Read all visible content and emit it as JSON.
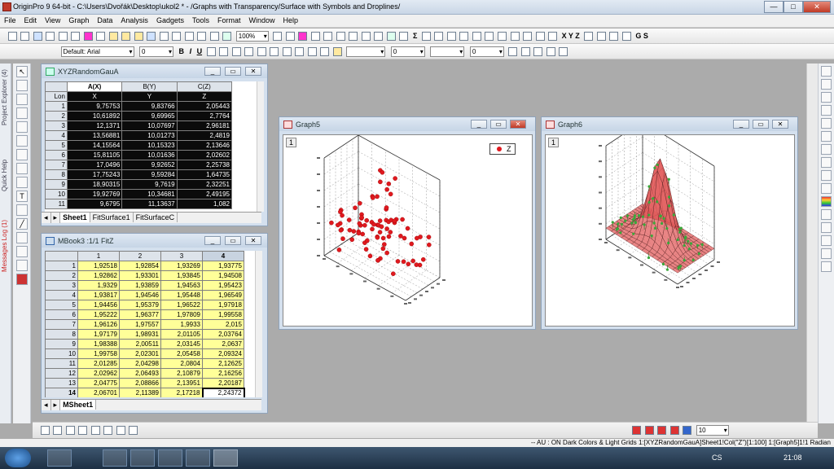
{
  "app": {
    "title": "OriginPro 9 64-bit - C:\\Users\\Dvořák\\Desktop\\ukol2 * - /Graphs with Transparency/Surface with Symbols and Droplines/",
    "min": "—",
    "max": "□",
    "close": "✕"
  },
  "menu": [
    "File",
    "Edit",
    "View",
    "Graph",
    "Data",
    "Analysis",
    "Gadgets",
    "Tools",
    "Format",
    "Window",
    "Help"
  ],
  "toolbar": {
    "zoom": "100%",
    "font_name": "Default: Arial",
    "font_size": "0",
    "text_bold": "B",
    "text_italic": "I",
    "text_underline": "U",
    "line_width": "0",
    "pattern_width": "0",
    "sigma": "Σ",
    "xyz": "X  Y  Z",
    "gs": "G  S"
  },
  "left_tabs": {
    "project_explorer": "Project Explorer (4)",
    "quick_help": "Quick Help",
    "messages": "Messages Log (1)"
  },
  "workbook1": {
    "title": "XYZRandomGauA",
    "columns": [
      "A(X)",
      "B(Y)",
      "C(Z)"
    ],
    "long_name_label": "Lon",
    "long_names": [
      "X",
      "Y",
      "Z"
    ],
    "rows": [
      [
        "1",
        "9,75753",
        "9,83766",
        "2,05443"
      ],
      [
        "2",
        "10,61892",
        "9,69965",
        "2,7764"
      ],
      [
        "3",
        "12,1371",
        "10,07697",
        "2,96181"
      ],
      [
        "4",
        "13,56881",
        "10,01273",
        "2,4819"
      ],
      [
        "5",
        "14,15564",
        "10,15323",
        "2,13646"
      ],
      [
        "6",
        "15,81105",
        "10,01636",
        "2,02602"
      ],
      [
        "7",
        "17,0496",
        "9,92652",
        "2,25738"
      ],
      [
        "8",
        "17,75243",
        "9,59284",
        "1,64735"
      ],
      [
        "9",
        "18,90315",
        "9,7619",
        "2,32251"
      ],
      [
        "10",
        "19,92769",
        "10,34681",
        "2,49195"
      ],
      [
        "11",
        "9,6795",
        "11,13637",
        "1,082"
      ]
    ],
    "tabs": [
      "Sheet1",
      "FitSurface1",
      "FitSurfaceC"
    ]
  },
  "matrix": {
    "title": "MBook3 :1/1 FitZ",
    "columns": [
      "1",
      "2",
      "3",
      "4"
    ],
    "rows": [
      [
        "1",
        "1,92518",
        "1,92854",
        "1,93269",
        "1,93775"
      ],
      [
        "2",
        "1,92862",
        "1,93301",
        "1,93845",
        "1,94508"
      ],
      [
        "3",
        "1,9329",
        "1,93859",
        "1,94563",
        "1,95423"
      ],
      [
        "4",
        "1,93817",
        "1,94546",
        "1,95448",
        "1,96549"
      ],
      [
        "5",
        "1,94456",
        "1,95379",
        "1,96522",
        "1,97918"
      ],
      [
        "6",
        "1,95222",
        "1,96377",
        "1,97809",
        "1,99558"
      ],
      [
        "7",
        "1,96126",
        "1,97557",
        "1,9933",
        "2,015"
      ],
      [
        "8",
        "1,97179",
        "1,98931",
        "2,01105",
        "2,03764"
      ],
      [
        "9",
        "1,98388",
        "2,00511",
        "2,03145",
        "2,0637"
      ],
      [
        "10",
        "1,99758",
        "2,02301",
        "2,05458",
        "2,09324"
      ],
      [
        "11",
        "2,01285",
        "2,04298",
        "2,0804",
        "2,12625"
      ],
      [
        "12",
        "2,02962",
        "2,06493",
        "2,10879",
        "2,16256"
      ],
      [
        "13",
        "2,04775",
        "2,08866",
        "2,13951",
        "2,20187"
      ],
      [
        "14",
        "2,06701",
        "2,11389",
        "2,17218",
        "2,24372"
      ]
    ],
    "tabs": [
      "MSheet1"
    ]
  },
  "graph5": {
    "title": "Graph5",
    "layer": "1",
    "legend": "Z",
    "color": "#e0191f"
  },
  "graph6": {
    "title": "Graph6",
    "layer": "1",
    "color": "#e15c5c"
  },
  "bottom_toolbar": {
    "size_value": "10"
  },
  "status": "-- AU : ON  Dark Colors & Light Grids  1:[XYZRandomGauA]Sheet1!Col(\"Z\")[1:100]  1:[Graph5]1!1  Radian",
  "taskbar": {
    "lang": "CS",
    "time": "21:08"
  }
}
